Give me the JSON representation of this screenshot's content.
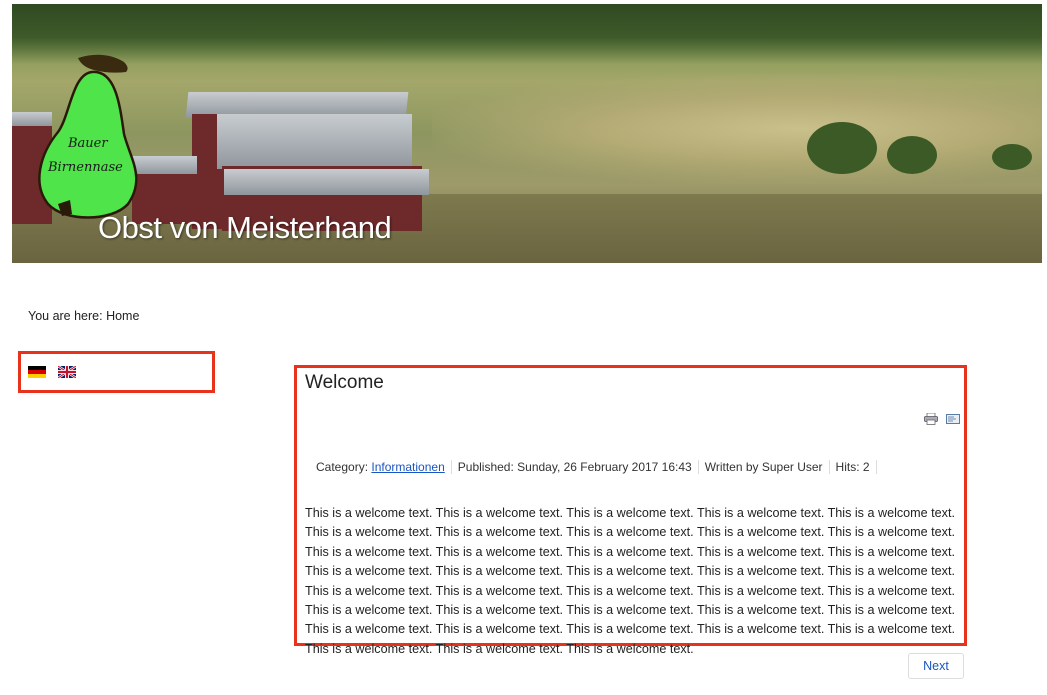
{
  "header": {
    "logo_line1": "Bauer",
    "logo_line2": "Birnennase",
    "title": "Obst von Meisterhand"
  },
  "breadcrumb": "You are here: Home",
  "languages": [
    {
      "name": "Deutsch",
      "icon": "german-flag-icon"
    },
    {
      "name": "English",
      "icon": "uk-flag-icon"
    }
  ],
  "article": {
    "title": "Welcome",
    "category_label": "Category:",
    "category_link": "Informationen",
    "published": "Published: Sunday, 26 February 2017 16:43",
    "author": "Written by Super User",
    "hits": "Hits: 2",
    "icons": [
      "print-icon",
      "email-icon"
    ],
    "body": "This is a welcome text. This is a welcome text. This is a welcome text. This is a welcome text. This is a welcome text. This is a welcome text. This is a welcome text. This is a welcome text. This is a welcome text. This is a welcome text. This is a welcome text. This is a welcome text. This is a welcome text. This is a welcome text. This is a welcome text. This is a welcome text. This is a welcome text. This is a welcome text. This is a welcome text. This is a welcome text. This is a welcome text. This is a welcome text. This is a welcome text. This is a welcome text. This is a welcome text. This is a welcome text. This is a welcome text. This is a welcome text. This is a welcome text. This is a welcome text. This is a welcome text. This is a welcome text. This is a welcome text. This is a welcome text. This is a welcome text. This is a welcome text. This is a welcome text. This is a welcome text."
  },
  "pagination": {
    "next_label": "Next"
  },
  "colors": {
    "highlight_border": "#e8321c",
    "link": "#1a55c4",
    "pear_green": "#4ee44a"
  }
}
